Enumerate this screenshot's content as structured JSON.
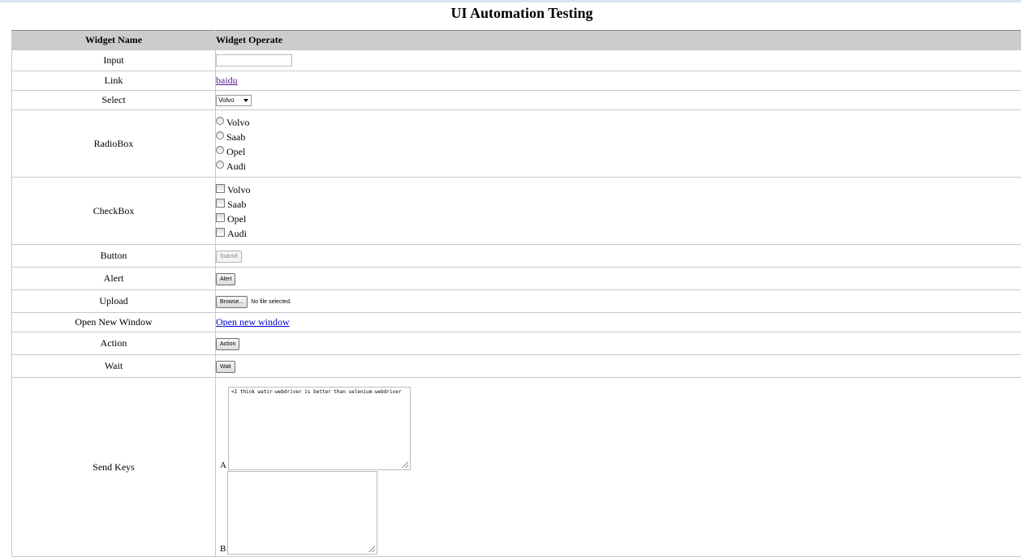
{
  "page": {
    "title": "UI Automation Testing"
  },
  "table": {
    "headers": {
      "name": "Widget Name",
      "operate": "Widget Operate"
    },
    "rows": {
      "input": {
        "label": "Input",
        "value": ""
      },
      "link": {
        "label": "Link",
        "link_text": "baidu"
      },
      "select": {
        "label": "Select",
        "selected": "Volvo"
      },
      "radio": {
        "label": "RadioBox",
        "options": [
          "Volvo",
          "Saab",
          "Opel",
          "Audi"
        ]
      },
      "checkbox": {
        "label": "CheckBox",
        "options": [
          "Volvo",
          "Saab",
          "Opel",
          "Audi"
        ]
      },
      "button": {
        "label": "Button",
        "button_text": "Submit",
        "disabled": true
      },
      "alert": {
        "label": "Alert",
        "button_text": "Alert"
      },
      "upload": {
        "label": "Upload",
        "button_text": "Browse...",
        "status": "No file selected."
      },
      "open_window": {
        "label": "Open New Window",
        "link_text": "Open new window"
      },
      "action": {
        "label": "Action",
        "button_text": "Action"
      },
      "wait": {
        "label": "Wait",
        "button_text": "Wait"
      },
      "send_keys": {
        "label": "Send Keys",
        "textarea_a_label": "A",
        "textarea_a_value": "<I think watir-webdriver is better than selenium-webdriver",
        "textarea_b_label": "B",
        "textarea_b_value": ""
      }
    }
  },
  "colors": {
    "header_bg": "#cccccc",
    "link": "#0000cc",
    "visited_link": "#551a8b",
    "border": "#c8c8c8"
  }
}
